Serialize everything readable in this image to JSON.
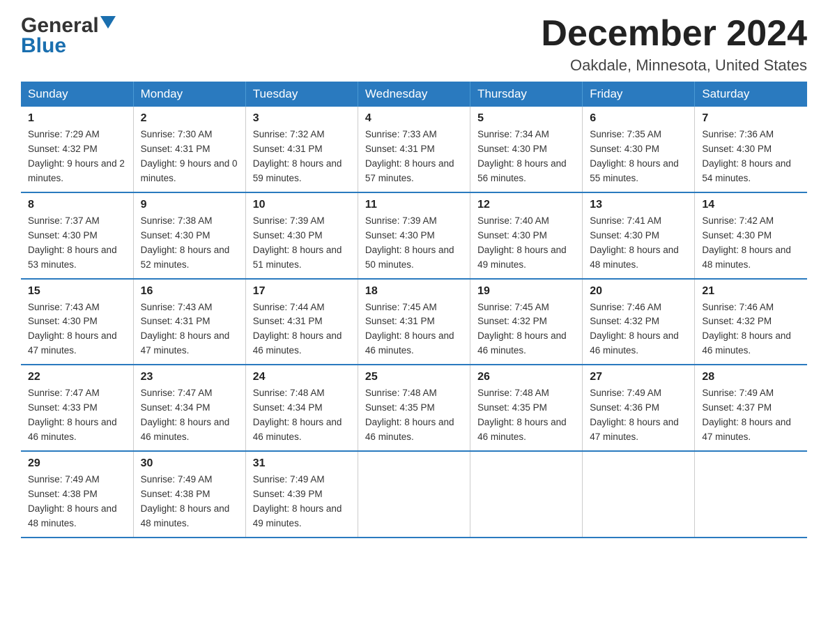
{
  "logo": {
    "text_black": "General",
    "text_blue": "Blue"
  },
  "header": {
    "month": "December 2024",
    "location": "Oakdale, Minnesota, United States"
  },
  "days_of_week": [
    "Sunday",
    "Monday",
    "Tuesday",
    "Wednesday",
    "Thursday",
    "Friday",
    "Saturday"
  ],
  "weeks": [
    [
      {
        "day": "1",
        "sunrise": "7:29 AM",
        "sunset": "4:32 PM",
        "daylight": "9 hours and 2 minutes."
      },
      {
        "day": "2",
        "sunrise": "7:30 AM",
        "sunset": "4:31 PM",
        "daylight": "9 hours and 0 minutes."
      },
      {
        "day": "3",
        "sunrise": "7:32 AM",
        "sunset": "4:31 PM",
        "daylight": "8 hours and 59 minutes."
      },
      {
        "day": "4",
        "sunrise": "7:33 AM",
        "sunset": "4:31 PM",
        "daylight": "8 hours and 57 minutes."
      },
      {
        "day": "5",
        "sunrise": "7:34 AM",
        "sunset": "4:30 PM",
        "daylight": "8 hours and 56 minutes."
      },
      {
        "day": "6",
        "sunrise": "7:35 AM",
        "sunset": "4:30 PM",
        "daylight": "8 hours and 55 minutes."
      },
      {
        "day": "7",
        "sunrise": "7:36 AM",
        "sunset": "4:30 PM",
        "daylight": "8 hours and 54 minutes."
      }
    ],
    [
      {
        "day": "8",
        "sunrise": "7:37 AM",
        "sunset": "4:30 PM",
        "daylight": "8 hours and 53 minutes."
      },
      {
        "day": "9",
        "sunrise": "7:38 AM",
        "sunset": "4:30 PM",
        "daylight": "8 hours and 52 minutes."
      },
      {
        "day": "10",
        "sunrise": "7:39 AM",
        "sunset": "4:30 PM",
        "daylight": "8 hours and 51 minutes."
      },
      {
        "day": "11",
        "sunrise": "7:39 AM",
        "sunset": "4:30 PM",
        "daylight": "8 hours and 50 minutes."
      },
      {
        "day": "12",
        "sunrise": "7:40 AM",
        "sunset": "4:30 PM",
        "daylight": "8 hours and 49 minutes."
      },
      {
        "day": "13",
        "sunrise": "7:41 AM",
        "sunset": "4:30 PM",
        "daylight": "8 hours and 48 minutes."
      },
      {
        "day": "14",
        "sunrise": "7:42 AM",
        "sunset": "4:30 PM",
        "daylight": "8 hours and 48 minutes."
      }
    ],
    [
      {
        "day": "15",
        "sunrise": "7:43 AM",
        "sunset": "4:30 PM",
        "daylight": "8 hours and 47 minutes."
      },
      {
        "day": "16",
        "sunrise": "7:43 AM",
        "sunset": "4:31 PM",
        "daylight": "8 hours and 47 minutes."
      },
      {
        "day": "17",
        "sunrise": "7:44 AM",
        "sunset": "4:31 PM",
        "daylight": "8 hours and 46 minutes."
      },
      {
        "day": "18",
        "sunrise": "7:45 AM",
        "sunset": "4:31 PM",
        "daylight": "8 hours and 46 minutes."
      },
      {
        "day": "19",
        "sunrise": "7:45 AM",
        "sunset": "4:32 PM",
        "daylight": "8 hours and 46 minutes."
      },
      {
        "day": "20",
        "sunrise": "7:46 AM",
        "sunset": "4:32 PM",
        "daylight": "8 hours and 46 minutes."
      },
      {
        "day": "21",
        "sunrise": "7:46 AM",
        "sunset": "4:32 PM",
        "daylight": "8 hours and 46 minutes."
      }
    ],
    [
      {
        "day": "22",
        "sunrise": "7:47 AM",
        "sunset": "4:33 PM",
        "daylight": "8 hours and 46 minutes."
      },
      {
        "day": "23",
        "sunrise": "7:47 AM",
        "sunset": "4:34 PM",
        "daylight": "8 hours and 46 minutes."
      },
      {
        "day": "24",
        "sunrise": "7:48 AM",
        "sunset": "4:34 PM",
        "daylight": "8 hours and 46 minutes."
      },
      {
        "day": "25",
        "sunrise": "7:48 AM",
        "sunset": "4:35 PM",
        "daylight": "8 hours and 46 minutes."
      },
      {
        "day": "26",
        "sunrise": "7:48 AM",
        "sunset": "4:35 PM",
        "daylight": "8 hours and 46 minutes."
      },
      {
        "day": "27",
        "sunrise": "7:49 AM",
        "sunset": "4:36 PM",
        "daylight": "8 hours and 47 minutes."
      },
      {
        "day": "28",
        "sunrise": "7:49 AM",
        "sunset": "4:37 PM",
        "daylight": "8 hours and 47 minutes."
      }
    ],
    [
      {
        "day": "29",
        "sunrise": "7:49 AM",
        "sunset": "4:38 PM",
        "daylight": "8 hours and 48 minutes."
      },
      {
        "day": "30",
        "sunrise": "7:49 AM",
        "sunset": "4:38 PM",
        "daylight": "8 hours and 48 minutes."
      },
      {
        "day": "31",
        "sunrise": "7:49 AM",
        "sunset": "4:39 PM",
        "daylight": "8 hours and 49 minutes."
      },
      null,
      null,
      null,
      null
    ]
  ]
}
